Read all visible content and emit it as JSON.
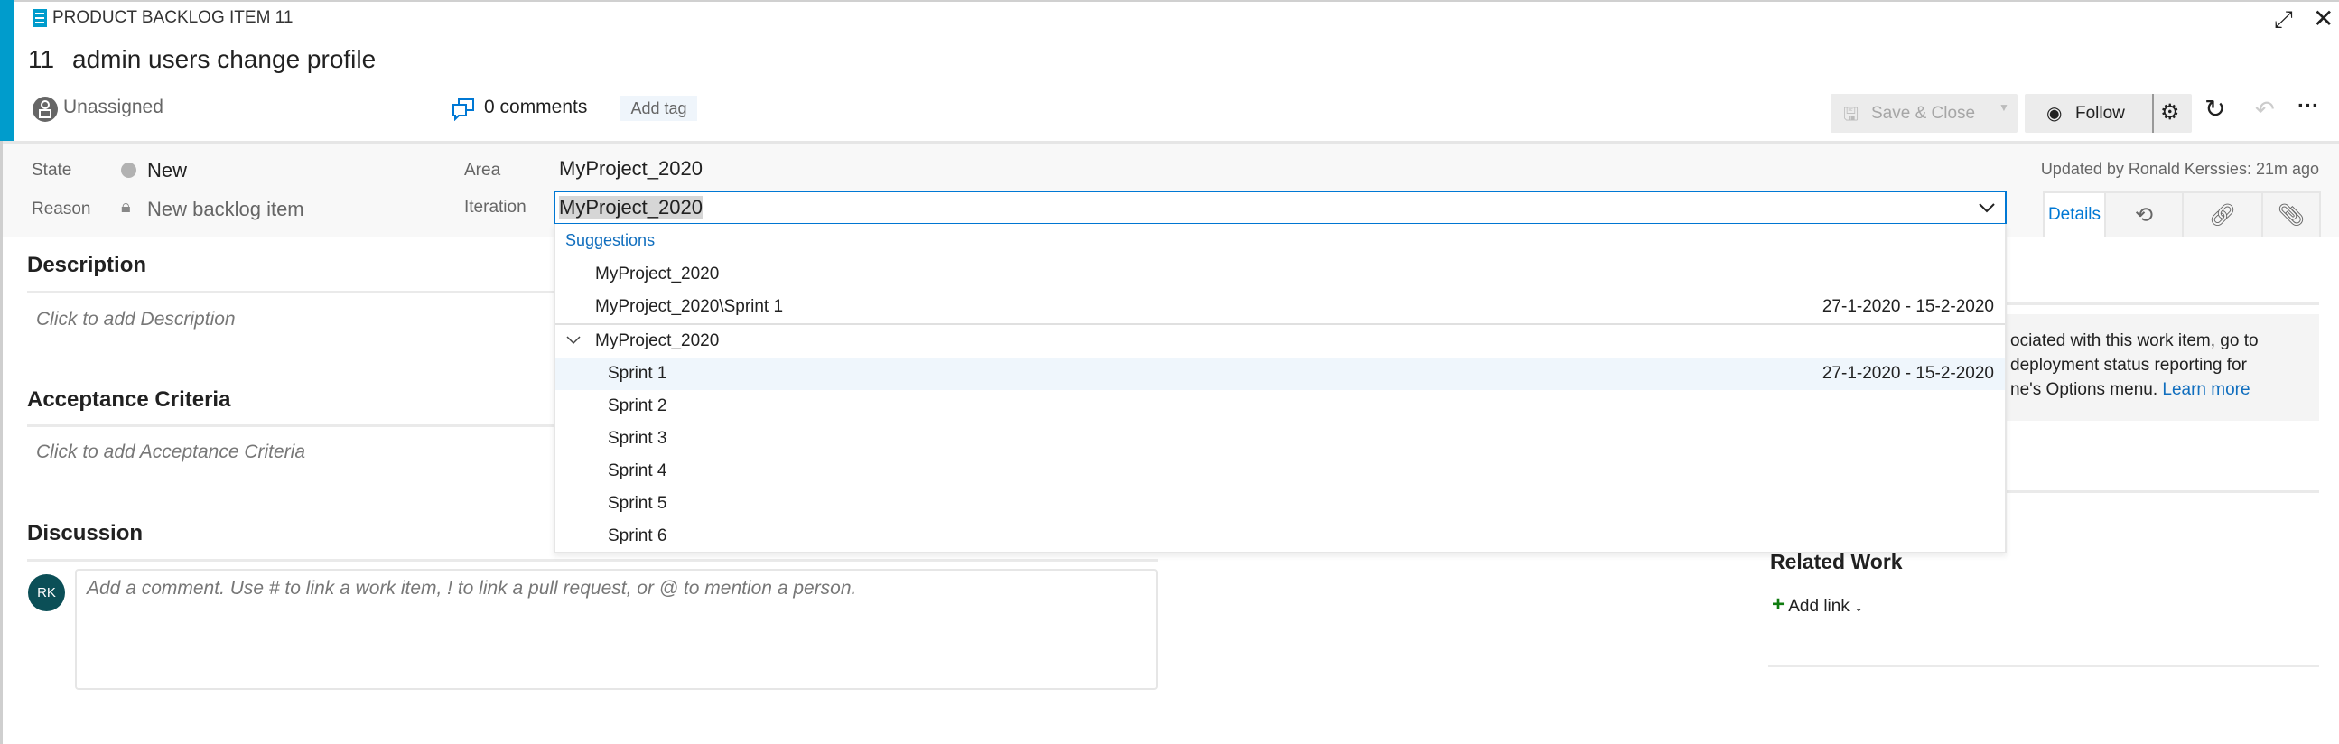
{
  "header": {
    "type_label": "PRODUCT BACKLOG ITEM 11",
    "id": "11",
    "title": "admin users change profile",
    "assignee": "Unassigned",
    "comments": "0 comments",
    "add_tag": "Add tag",
    "accent": "#009ccc"
  },
  "toolbar": {
    "save_close": "Save & Close",
    "follow": "Follow"
  },
  "fields": {
    "state_label": "State",
    "state_value": "New",
    "state_color": "#b2b2b2",
    "reason_label": "Reason",
    "reason_value": "New backlog item",
    "area_label": "Area",
    "area_value": "MyProject_2020",
    "iteration_label": "Iteration",
    "iteration_value": "MyProject_2020",
    "updated": "Updated by Ronald Kerssies: 21m ago"
  },
  "tabs": {
    "details": "Details"
  },
  "dropdown": {
    "suggestions_label": "Suggestions",
    "suggestions": [
      {
        "label": "MyProject_2020",
        "dates": ""
      },
      {
        "label": "MyProject_2020\\Sprint 1",
        "dates": "27-1-2020 - 15-2-2020"
      }
    ],
    "tree_root": "MyProject_2020",
    "tree_items": [
      {
        "label": "Sprint 1",
        "dates": "27-1-2020 - 15-2-2020",
        "highlighted": true
      },
      {
        "label": "Sprint 2",
        "dates": ""
      },
      {
        "label": "Sprint 3",
        "dates": ""
      },
      {
        "label": "Sprint 4",
        "dates": ""
      },
      {
        "label": "Sprint 5",
        "dates": ""
      },
      {
        "label": "Sprint 6",
        "dates": ""
      }
    ]
  },
  "main": {
    "description_title": "Description",
    "description_placeholder": "Click to add Description",
    "acceptance_title": "Acceptance Criteria",
    "acceptance_placeholder": "Click to add Acceptance Criteria",
    "discussion_title": "Discussion",
    "avatar_initials": "RK",
    "avatar_color": "#0b4f57",
    "comment_placeholder": "Add a comment. Use # to link a work item, ! to link a pull request, or @ to mention a person."
  },
  "right": {
    "info_line1": "ociated with this work item, go to",
    "info_line2": "deployment status reporting for",
    "info_line3": "ne's Options menu.",
    "learn_more": "Learn more",
    "related_title": "Related Work",
    "add_link": "Add link"
  }
}
